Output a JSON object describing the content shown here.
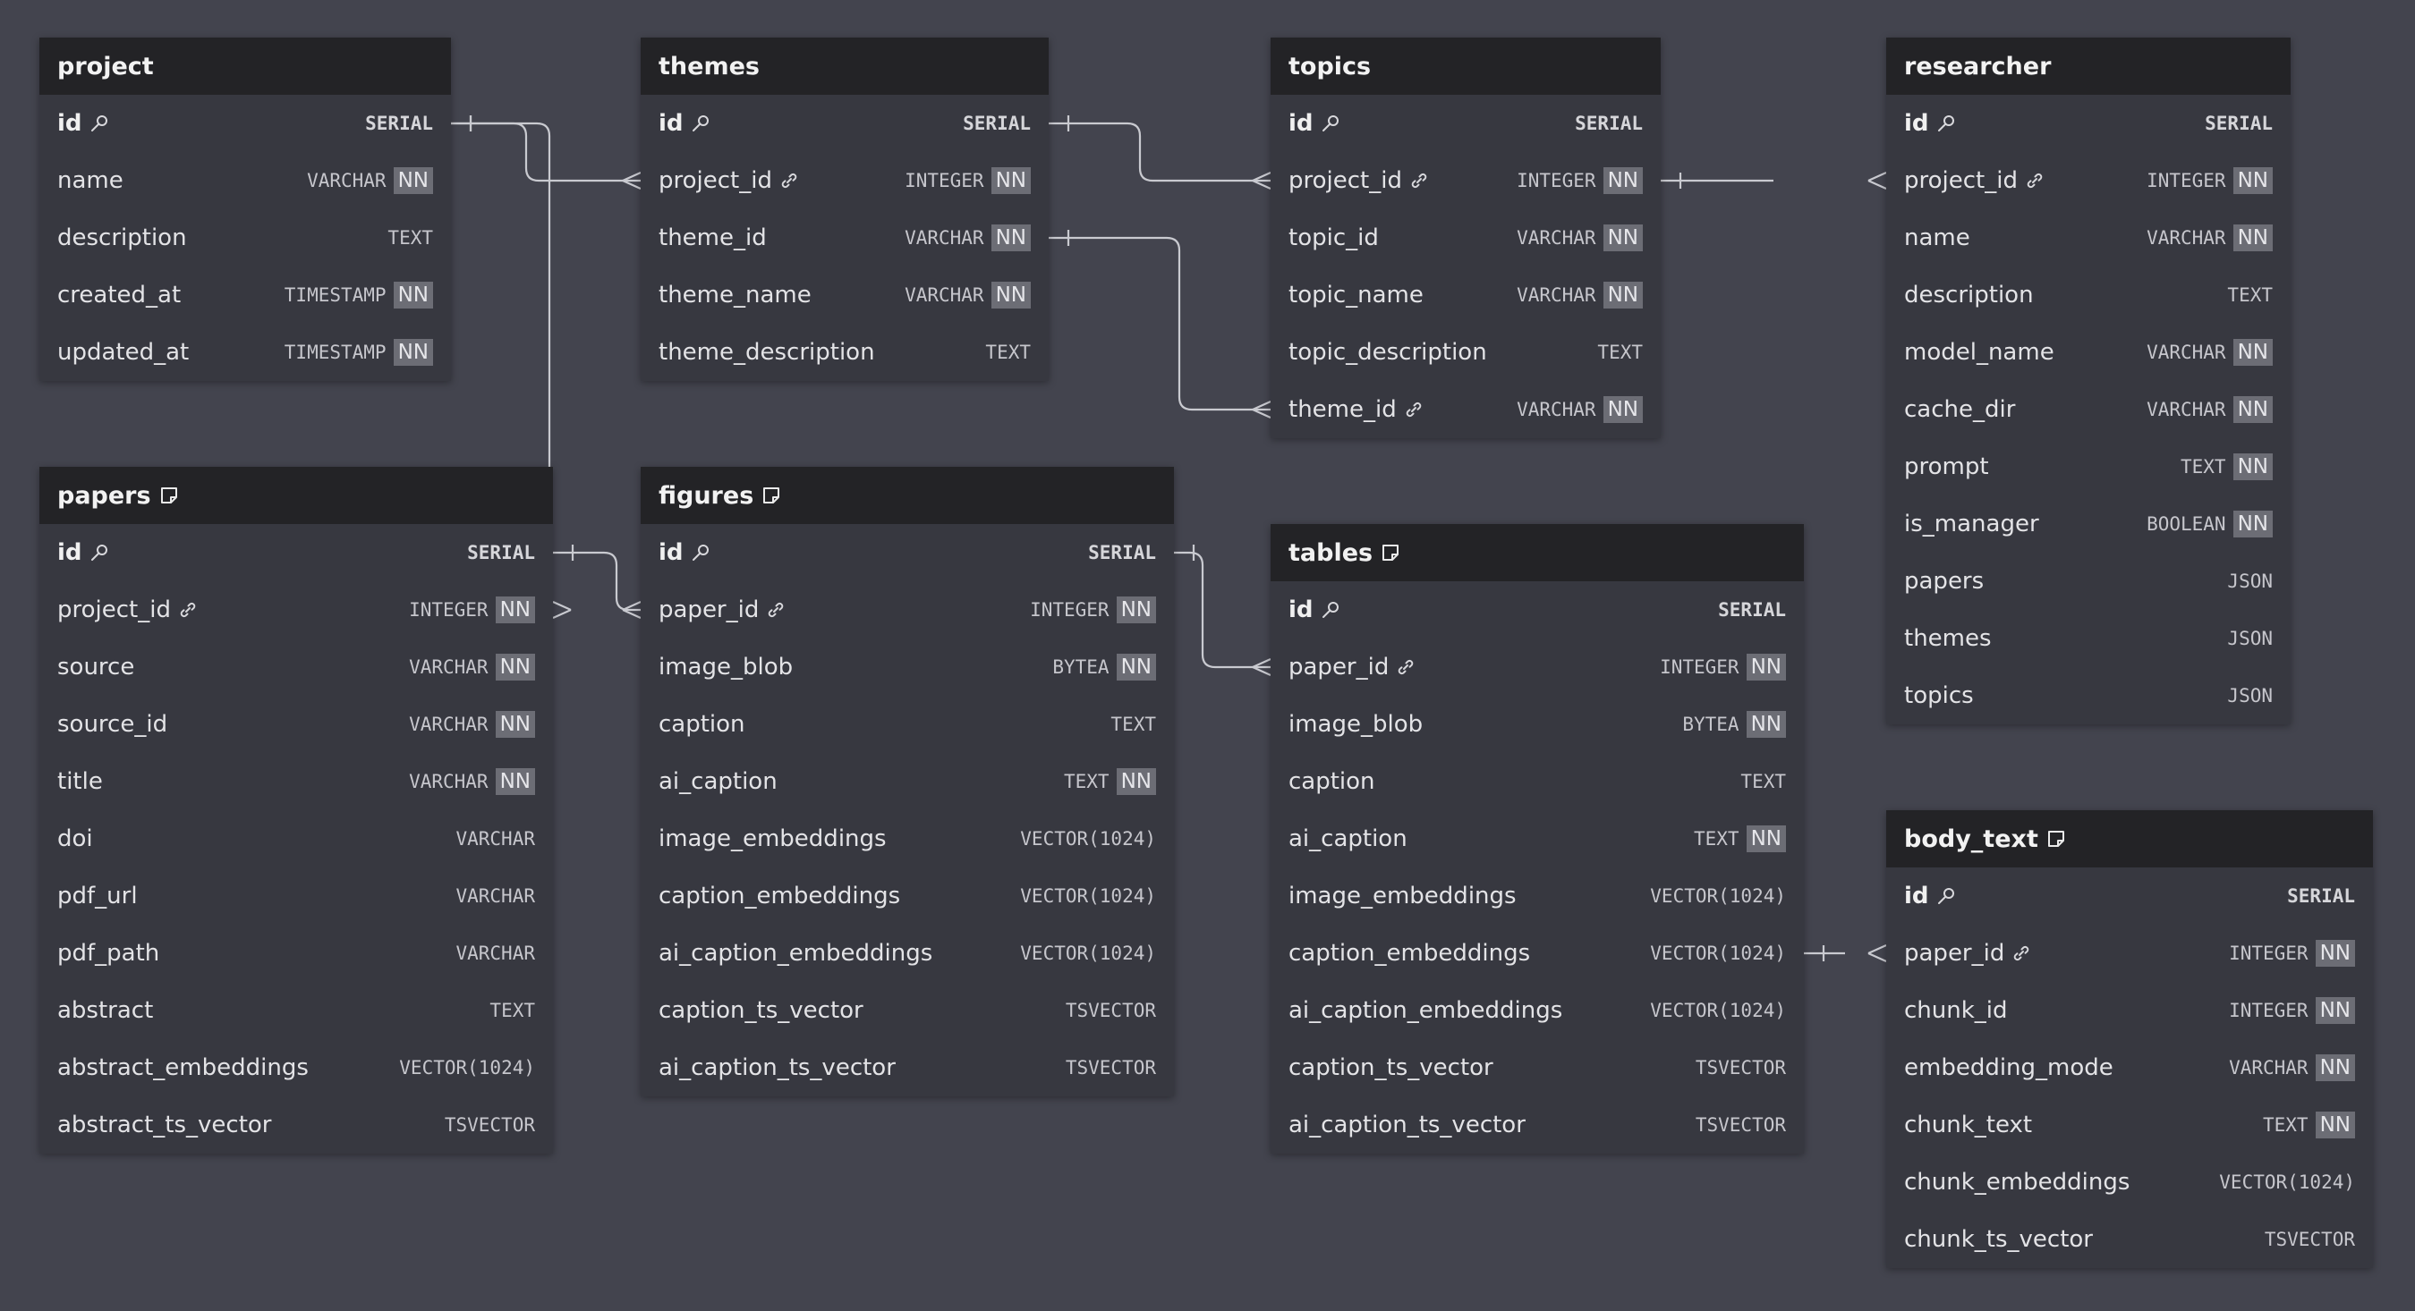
{
  "tables": [
    {
      "key": "project",
      "name": "project",
      "note": false,
      "fields": [
        {
          "name": "id",
          "type": "SERIAL",
          "pk": true,
          "nn": false,
          "fk": false
        },
        {
          "name": "name",
          "type": "VARCHAR",
          "pk": false,
          "nn": true,
          "fk": false
        },
        {
          "name": "description",
          "type": "TEXT",
          "pk": false,
          "nn": false,
          "fk": false
        },
        {
          "name": "created_at",
          "type": "TIMESTAMP",
          "pk": false,
          "nn": true,
          "fk": false
        },
        {
          "name": "updated_at",
          "type": "TIMESTAMP",
          "pk": false,
          "nn": true,
          "fk": false
        }
      ]
    },
    {
      "key": "themes",
      "name": "themes",
      "note": false,
      "fields": [
        {
          "name": "id",
          "type": "SERIAL",
          "pk": true,
          "nn": false,
          "fk": false
        },
        {
          "name": "project_id",
          "type": "INTEGER",
          "pk": false,
          "nn": true,
          "fk": true
        },
        {
          "name": "theme_id",
          "type": "VARCHAR",
          "pk": false,
          "nn": true,
          "fk": false
        },
        {
          "name": "theme_name",
          "type": "VARCHAR",
          "pk": false,
          "nn": true,
          "fk": false
        },
        {
          "name": "theme_description",
          "type": "TEXT",
          "pk": false,
          "nn": false,
          "fk": false
        }
      ]
    },
    {
      "key": "topics",
      "name": "topics",
      "note": false,
      "fields": [
        {
          "name": "id",
          "type": "SERIAL",
          "pk": true,
          "nn": false,
          "fk": false
        },
        {
          "name": "project_id",
          "type": "INTEGER",
          "pk": false,
          "nn": true,
          "fk": true
        },
        {
          "name": "topic_id",
          "type": "VARCHAR",
          "pk": false,
          "nn": true,
          "fk": false
        },
        {
          "name": "topic_name",
          "type": "VARCHAR",
          "pk": false,
          "nn": true,
          "fk": false
        },
        {
          "name": "topic_description",
          "type": "TEXT",
          "pk": false,
          "nn": false,
          "fk": false
        },
        {
          "name": "theme_id",
          "type": "VARCHAR",
          "pk": false,
          "nn": true,
          "fk": true
        }
      ]
    },
    {
      "key": "researcher",
      "name": "researcher",
      "note": false,
      "fields": [
        {
          "name": "id",
          "type": "SERIAL",
          "pk": true,
          "nn": false,
          "fk": false
        },
        {
          "name": "project_id",
          "type": "INTEGER",
          "pk": false,
          "nn": true,
          "fk": true
        },
        {
          "name": "name",
          "type": "VARCHAR",
          "pk": false,
          "nn": true,
          "fk": false
        },
        {
          "name": "description",
          "type": "TEXT",
          "pk": false,
          "nn": false,
          "fk": false
        },
        {
          "name": "model_name",
          "type": "VARCHAR",
          "pk": false,
          "nn": true,
          "fk": false
        },
        {
          "name": "cache_dir",
          "type": "VARCHAR",
          "pk": false,
          "nn": true,
          "fk": false
        },
        {
          "name": "prompt",
          "type": "TEXT",
          "pk": false,
          "nn": true,
          "fk": false
        },
        {
          "name": "is_manager",
          "type": "BOOLEAN",
          "pk": false,
          "nn": true,
          "fk": false
        },
        {
          "name": "papers",
          "type": "JSON",
          "pk": false,
          "nn": false,
          "fk": false
        },
        {
          "name": "themes",
          "type": "JSON",
          "pk": false,
          "nn": false,
          "fk": false
        },
        {
          "name": "topics",
          "type": "JSON",
          "pk": false,
          "nn": false,
          "fk": false
        }
      ]
    },
    {
      "key": "papers",
      "name": "papers",
      "note": true,
      "fields": [
        {
          "name": "id",
          "type": "SERIAL",
          "pk": true,
          "nn": false,
          "fk": false
        },
        {
          "name": "project_id",
          "type": "INTEGER",
          "pk": false,
          "nn": true,
          "fk": true
        },
        {
          "name": "source",
          "type": "VARCHAR",
          "pk": false,
          "nn": true,
          "fk": false
        },
        {
          "name": "source_id",
          "type": "VARCHAR",
          "pk": false,
          "nn": true,
          "fk": false
        },
        {
          "name": "title",
          "type": "VARCHAR",
          "pk": false,
          "nn": true,
          "fk": false
        },
        {
          "name": "doi",
          "type": "VARCHAR",
          "pk": false,
          "nn": false,
          "fk": false
        },
        {
          "name": "pdf_url",
          "type": "VARCHAR",
          "pk": false,
          "nn": false,
          "fk": false
        },
        {
          "name": "pdf_path",
          "type": "VARCHAR",
          "pk": false,
          "nn": false,
          "fk": false
        },
        {
          "name": "abstract",
          "type": "TEXT",
          "pk": false,
          "nn": false,
          "fk": false
        },
        {
          "name": "abstract_embeddings",
          "type": "VECTOR(1024)",
          "pk": false,
          "nn": false,
          "fk": false
        },
        {
          "name": "abstract_ts_vector",
          "type": "TSVECTOR",
          "pk": false,
          "nn": false,
          "fk": false
        }
      ]
    },
    {
      "key": "figures",
      "name": "figures",
      "note": true,
      "fields": [
        {
          "name": "id",
          "type": "SERIAL",
          "pk": true,
          "nn": false,
          "fk": false
        },
        {
          "name": "paper_id",
          "type": "INTEGER",
          "pk": false,
          "nn": true,
          "fk": true
        },
        {
          "name": "image_blob",
          "type": "BYTEA",
          "pk": false,
          "nn": true,
          "fk": false
        },
        {
          "name": "caption",
          "type": "TEXT",
          "pk": false,
          "nn": false,
          "fk": false
        },
        {
          "name": "ai_caption",
          "type": "TEXT",
          "pk": false,
          "nn": true,
          "fk": false
        },
        {
          "name": "image_embeddings",
          "type": "VECTOR(1024)",
          "pk": false,
          "nn": false,
          "fk": false
        },
        {
          "name": "caption_embeddings",
          "type": "VECTOR(1024)",
          "pk": false,
          "nn": false,
          "fk": false
        },
        {
          "name": "ai_caption_embeddings",
          "type": "VECTOR(1024)",
          "pk": false,
          "nn": false,
          "fk": false
        },
        {
          "name": "caption_ts_vector",
          "type": "TSVECTOR",
          "pk": false,
          "nn": false,
          "fk": false
        },
        {
          "name": "ai_caption_ts_vector",
          "type": "TSVECTOR",
          "pk": false,
          "nn": false,
          "fk": false
        }
      ]
    },
    {
      "key": "tables",
      "name": "tables",
      "note": true,
      "fields": [
        {
          "name": "id",
          "type": "SERIAL",
          "pk": true,
          "nn": false,
          "fk": false
        },
        {
          "name": "paper_id",
          "type": "INTEGER",
          "pk": false,
          "nn": true,
          "fk": true
        },
        {
          "name": "image_blob",
          "type": "BYTEA",
          "pk": false,
          "nn": true,
          "fk": false
        },
        {
          "name": "caption",
          "type": "TEXT",
          "pk": false,
          "nn": false,
          "fk": false
        },
        {
          "name": "ai_caption",
          "type": "TEXT",
          "pk": false,
          "nn": true,
          "fk": false
        },
        {
          "name": "image_embeddings",
          "type": "VECTOR(1024)",
          "pk": false,
          "nn": false,
          "fk": false
        },
        {
          "name": "caption_embeddings",
          "type": "VECTOR(1024)",
          "pk": false,
          "nn": false,
          "fk": false
        },
        {
          "name": "ai_caption_embeddings",
          "type": "VECTOR(1024)",
          "pk": false,
          "nn": false,
          "fk": false
        },
        {
          "name": "caption_ts_vector",
          "type": "TSVECTOR",
          "pk": false,
          "nn": false,
          "fk": false
        },
        {
          "name": "ai_caption_ts_vector",
          "type": "TSVECTOR",
          "pk": false,
          "nn": false,
          "fk": false
        }
      ]
    },
    {
      "key": "body_text",
      "name": "body_text",
      "note": true,
      "fields": [
        {
          "name": "id",
          "type": "SERIAL",
          "pk": true,
          "nn": false,
          "fk": false
        },
        {
          "name": "paper_id",
          "type": "INTEGER",
          "pk": false,
          "nn": true,
          "fk": true
        },
        {
          "name": "chunk_id",
          "type": "INTEGER",
          "pk": false,
          "nn": true,
          "fk": false
        },
        {
          "name": "embedding_mode",
          "type": "VARCHAR",
          "pk": false,
          "nn": true,
          "fk": false
        },
        {
          "name": "chunk_text",
          "type": "TEXT",
          "pk": false,
          "nn": true,
          "fk": false
        },
        {
          "name": "chunk_embeddings",
          "type": "VECTOR(1024)",
          "pk": false,
          "nn": false,
          "fk": false
        },
        {
          "name": "chunk_ts_vector",
          "type": "TSVECTOR",
          "pk": false,
          "nn": false,
          "fk": false
        }
      ]
    }
  ],
  "relations": [
    {
      "from": "project.id",
      "to": "themes.project_id"
    },
    {
      "from": "project.id",
      "to": "papers.project_id"
    },
    {
      "from": "themes.theme_id",
      "to": "topics.theme_id"
    },
    {
      "from": "themes.id",
      "to": "topics.project_id"
    },
    {
      "from": "topics.project_id",
      "to": "researcher.project_id"
    },
    {
      "from": "papers.id",
      "to": "figures.paper_id"
    },
    {
      "from": "figures.id",
      "to": "tables.paper_id"
    },
    {
      "from": "tables.caption_embeddings",
      "to": "body_text.paper_id"
    }
  ],
  "nn_label": "NN",
  "colors": {
    "background": "#43444e",
    "table_body": "#373840",
    "table_header": "#232326",
    "badge": "#6c6d75",
    "line": "#c9cad0"
  }
}
